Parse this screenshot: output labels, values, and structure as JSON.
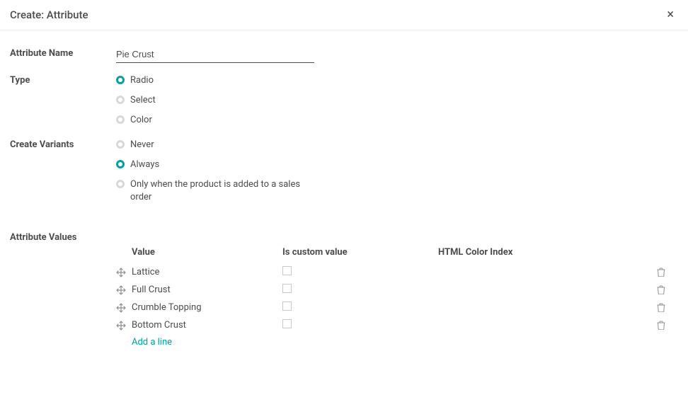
{
  "modal": {
    "title": "Create: Attribute"
  },
  "labels": {
    "attribute_name": "Attribute Name",
    "type": "Type",
    "create_variants": "Create Variants",
    "attribute_values": "Attribute Values"
  },
  "fields": {
    "attribute_name_value": "Pie Crust"
  },
  "type_options": {
    "radio": "Radio",
    "select": "Select",
    "color": "Color"
  },
  "variant_options": {
    "never": "Never",
    "always": "Always",
    "only_sales": "Only when the product is added to a sales order"
  },
  "table": {
    "headers": {
      "value": "Value",
      "custom": "Is custom value",
      "color": "HTML Color Index"
    },
    "rows": [
      {
        "value": "Lattice"
      },
      {
        "value": "Full Crust"
      },
      {
        "value": "Crumble Topping"
      },
      {
        "value": "Bottom Crust"
      }
    ],
    "add_line": "Add a line"
  }
}
